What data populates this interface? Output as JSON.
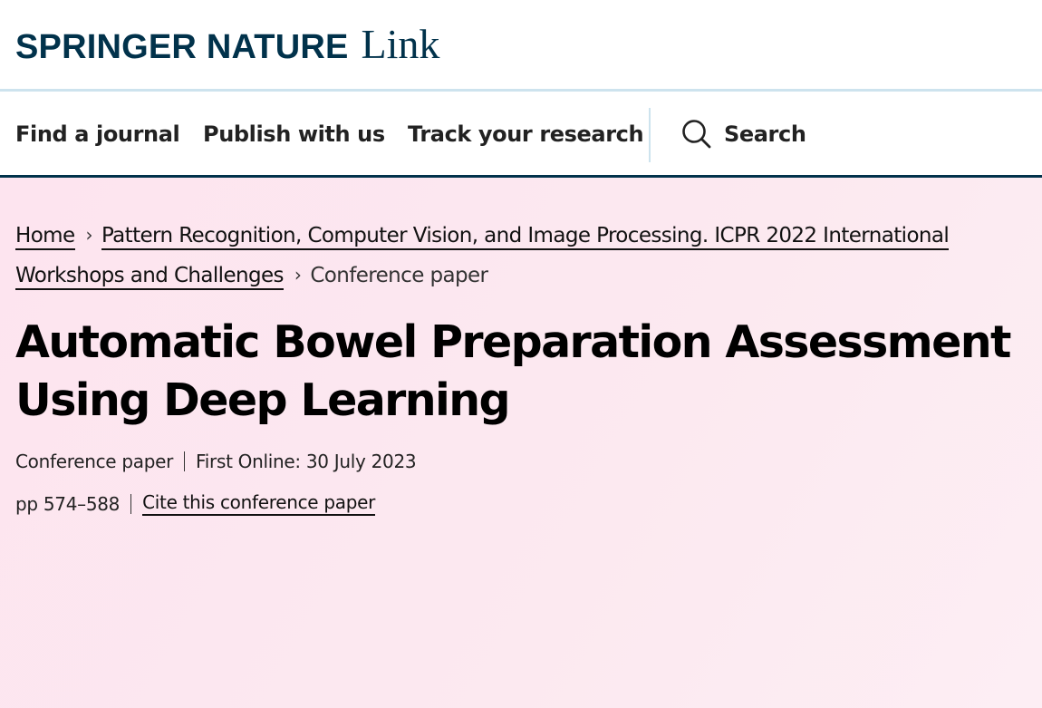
{
  "brand": {
    "springer": "SPRINGER NATURE",
    "link": "Link"
  },
  "nav": {
    "items": [
      {
        "label": "Find a journal"
      },
      {
        "label": "Publish with us"
      },
      {
        "label": "Track your research"
      }
    ],
    "search_label": "Search"
  },
  "breadcrumb": {
    "home": "Home",
    "parent": "Pattern Recognition, Computer Vision, and Image Processing. ICPR 2022 International Workshops and Challenges",
    "current": "Conference paper"
  },
  "article": {
    "title": "Automatic Bowel Preparation Assessment Using Deep Learning",
    "type": "Conference paper",
    "first_online": "First Online: 30 July 2023",
    "pages": "pp 574–588",
    "cite_label": "Cite this conference paper"
  },
  "colors": {
    "brand": "#01324b",
    "background": "#fce8f0"
  }
}
